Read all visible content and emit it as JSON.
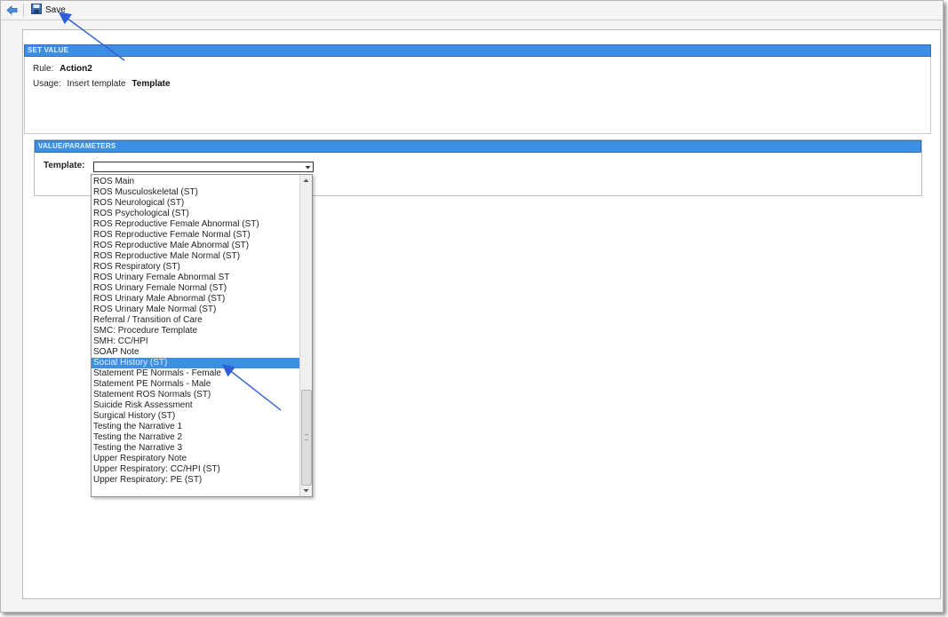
{
  "toolbar": {
    "back_icon": "back-arrow-icon",
    "save_icon": "floppy-disk-icon",
    "save_label": "Save"
  },
  "set_value": {
    "header": "SET VALUE",
    "rule_label": "Rule:",
    "rule_value": "Action2",
    "usage_label": "Usage:",
    "usage_value_1": "Insert template",
    "usage_value_2": "Template"
  },
  "value_section": {
    "header": "VALUE/PARAMETERS",
    "template_label": "Template:",
    "template_selected": ""
  },
  "dropdown": {
    "items": [
      "ROS Main",
      "ROS Musculoskeletal (ST)",
      "ROS Neurological (ST)",
      "ROS Psychological (ST)",
      "ROS Reproductive Female Abnormal (ST)",
      "ROS Reproductive Female Normal (ST)",
      "ROS Reproductive Male Abnormal (ST)",
      "ROS Reproductive Male Normal (ST)",
      "ROS Respiratory (ST)",
      "ROS Urinary Female Abnormal ST",
      "ROS Urinary Female Normal (ST)",
      "ROS Urinary Male Abnormal (ST)",
      "ROS Urinary Male Normal (ST)",
      "Referral / Transition of Care",
      "SMC: Procedure Template",
      "SMH: CC/HPI",
      "SOAP Note",
      "Social History (ST)",
      "Statement PE Normals - Female",
      "Statement PE Normals - Male",
      "Statement ROS Normals (ST)",
      "Suicide Risk Assessment",
      "Surgical History (ST)",
      "Testing the Narrative 1",
      "Testing the Narrative 2",
      "Testing the Narrative 3",
      "Upper Respiratory Note",
      "Upper Respiratory: CC/HPI (ST)",
      "Upper Respiratory: PE (ST)"
    ],
    "selected_index": 17
  },
  "colors": {
    "accent": "#3d8fe6",
    "annotation_arrow": "#2f5fd8"
  }
}
